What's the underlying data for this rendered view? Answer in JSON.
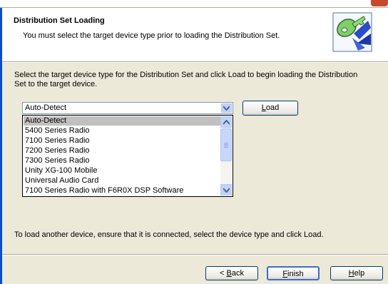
{
  "header": {
    "title": "Distribution Set Loading",
    "subtitle": "You must select the target device type prior to loading the Distribution Set."
  },
  "instruction": "Select the target device type for the Distribution Set and click Load to begin loading the Distribution Set to the target device.",
  "device_combo": {
    "selected": "Auto-Detect",
    "options": [
      "Auto-Detect",
      "5400 Series Radio",
      "7100 Series Radio",
      "7200 Series Radio",
      "7300 Series Radio",
      "Unity XG-100 Mobile",
      "Universal Audio Card",
      "7100 Series Radio with F6R0X DSP Software"
    ]
  },
  "load_button": {
    "accel": "L",
    "rest": "oad"
  },
  "note": "To load another device, ensure that it is connected, select the device type and click Load.",
  "footer": {
    "back": {
      "prefix": "< ",
      "accel": "B",
      "rest": "ack"
    },
    "finish": {
      "accel": "F",
      "rest": "inish"
    },
    "help": {
      "accel": "H",
      "rest": "elp"
    }
  },
  "colors": {
    "selection": "#c0c0c0",
    "accent_border": "#003c74"
  },
  "icons": [
    "key-icon",
    "chevron-down-icon",
    "scroll-up-icon",
    "scroll-down-icon"
  ]
}
